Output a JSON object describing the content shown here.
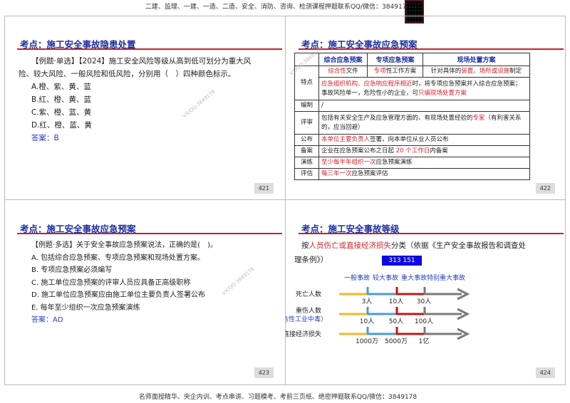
{
  "header": {
    "text": "二建、监理、一建、一造、二造、安全、消防、咨询、检测课程押题联系QQ/微信：3849178"
  },
  "footer": {
    "text": "名师面授精华、央企内训、考点串讲、习题模考、考前三页纸、绝密押题联系QQ/微信：3849178"
  },
  "watermark": "VX/QQ:3849178",
  "slides": [
    {
      "title": "考点：施工安全事故隐患处置",
      "page": "421",
      "lines": [
        "【例题·单选】【2024】施工安全风险等级从高到低可划分为重大风",
        "险、较大风险、一般风险和低风险，分别用（　）四种颜色标示。",
        "A.橙、紫、黄、蓝",
        "B.红、橙、黄、蓝",
        "C.紫、橙、蓝、黄",
        "D.红、橙、蓝、黄"
      ],
      "answer": "答案：B"
    },
    {
      "title": "考点：施工安全事故应急预案",
      "page": "422",
      "table": {
        "headers": [
          "综合应急预案",
          "专项应急预案",
          "现场处置方案"
        ],
        "feature_label": "特点",
        "feature_row": [
          [
            {
              "t": "综合性",
              "r": 1
            },
            {
              "t": "文件"
            }
          ],
          [
            {
              "t": "专项",
              "r": 1
            },
            {
              "t": "性工作方案"
            }
          ],
          [
            {
              "t": "针对具体的"
            },
            {
              "t": "装置、场所或设施",
              "r": 1
            },
            {
              "t": "制定"
            }
          ]
        ],
        "feature_merged": [
          {
            "t": "应急组织机构、应急响应程序相近",
            "r": 1
          },
          {
            "t": "时，将专项应急预案并入综合应急预案；事故风险单一，危险性小的企业，可"
          },
          {
            "t": "只编现场处置方案",
            "r": 1
          }
        ],
        "rows": [
          {
            "label": "编制",
            "content": [
              {
                "t": "/"
              }
            ]
          },
          {
            "label": "评审",
            "content": [
              {
                "t": "包括有关安全生产及应急管理方面的、有现场处置经验的"
              },
              {
                "t": "专家",
                "r": 1
              },
              {
                "t": "（有利害关系的，应当回避）"
              }
            ]
          },
          {
            "label": "公布",
            "content": [
              {
                "t": "本单位主要负责人",
                "r": 1
              },
              {
                "t": "签署，向本单位从业人员公布"
              }
            ]
          },
          {
            "label": "备案",
            "content": [
              {
                "t": "企业在应急预案公布之日起 "
              },
              {
                "t": "20 个工作日",
                "r": 1
              },
              {
                "t": "内备案"
              }
            ]
          },
          {
            "label": "演练",
            "content": [
              {
                "t": "至少每半年组织一次",
                "r": 1
              },
              {
                "t": "应急预案演练"
              }
            ]
          },
          {
            "label": "评估",
            "content": [
              {
                "t": "每三年一次",
                "r": 1
              },
              {
                "t": "应急预案评估"
              }
            ]
          }
        ]
      }
    },
    {
      "title": "考点：施工安全事故应急预案",
      "page": "423",
      "lines": [
        "【例题·多选】关于安全事故应急预案说法，正确的是(　)。",
        "A. 包括综合应急预案、专项应急预案和现场处置方案。",
        "B. 专项应急预案必须编写",
        "C. 施工单位应急预案的评审人员应具备正高级职称",
        "D. 施工单位应急预案应由施工单位主要负责人签署公布",
        "E. 每年至少组织一次应急预案演练"
      ],
      "answer": "答案：AD"
    },
    {
      "title": "考点：施工安全事故等级",
      "page": "424",
      "intro_pre": "按",
      "intro_red": "人员伤亡或直接经济损失",
      "intro_post": "分类（依据《生产安全事故报告和调查处",
      "intro_line2": "理条例》）",
      "badge": "313 151",
      "levels": [
        "一般事故",
        "较大事故",
        "重大事故",
        "特别重大事故"
      ],
      "rows": [
        {
          "label": "死亡人数",
          "sub": "",
          "ticks": [
            "3人",
            "10人",
            "30人"
          ]
        },
        {
          "label": "重伤人数",
          "sub": "（急性工业中毒）",
          "ticks": [
            "10人",
            "50人",
            "100人"
          ]
        },
        {
          "label": "直接经济损失",
          "sub": "",
          "ticks": [
            "1000万",
            "5000万",
            "1亿"
          ]
        }
      ],
      "colors": {
        "general": "#f2b824",
        "larger": "#4a9ad8",
        "major": "#c01818",
        "extra": "#7a7a7a"
      }
    }
  ]
}
